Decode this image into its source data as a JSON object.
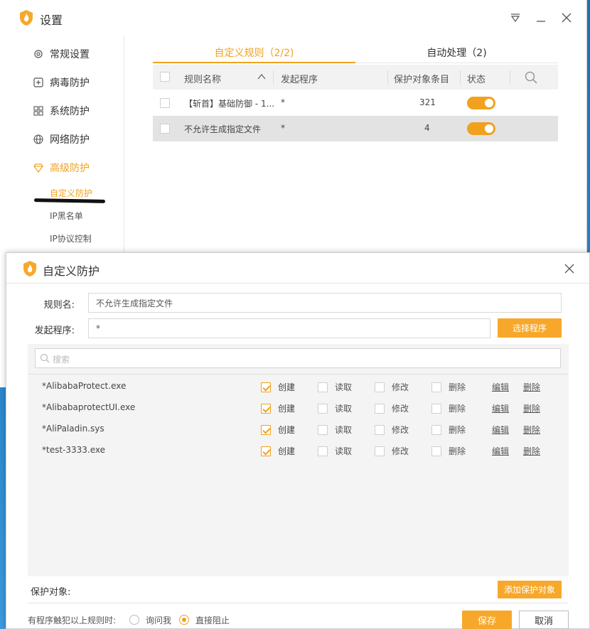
{
  "colors": {
    "accent": "#f0a21e",
    "button": "#f7a82a",
    "selected_row": "#e3e3e3"
  },
  "main_window": {
    "title": "设置",
    "controls": [
      "dropdown-icon",
      "minimize-icon",
      "close-icon"
    ],
    "sidebar": {
      "items": [
        {
          "label": "常规设置",
          "icon": "gear-icon"
        },
        {
          "label": "病毒防护",
          "icon": "plus-box-icon"
        },
        {
          "label": "系统防护",
          "icon": "grid-icon"
        },
        {
          "label": "网络防护",
          "icon": "globe-icon"
        },
        {
          "label": "高级防护",
          "icon": "diamond-icon",
          "active": true
        }
      ],
      "subitems": [
        {
          "label": "自定义防护",
          "active": true
        },
        {
          "label": "IP黑名单"
        },
        {
          "label": "IP协议控制"
        }
      ]
    },
    "tabs": [
      {
        "label": "自定义规则（2/2)",
        "active": true
      },
      {
        "label": "自动处理（2)"
      }
    ],
    "table": {
      "headers": [
        "规则名称",
        "发起程序",
        "保护对象条目",
        "状态"
      ],
      "rows": [
        {
          "name": "【斩首】基础防御 - 1...",
          "program": "*",
          "count": "321",
          "enabled": true
        },
        {
          "name": "不允许生成指定文件",
          "program": "*",
          "count": "4",
          "enabled": true,
          "selected": true
        }
      ]
    }
  },
  "dialog": {
    "title": "自定义防护",
    "rule_name_label": "规则名:",
    "rule_name_value": "不允许生成指定文件",
    "program_label": "发起程序:",
    "program_value": "*",
    "select_program_button": "选择程序",
    "search_placeholder": "搜索",
    "permission_labels": [
      "创建",
      "读取",
      "修改",
      "删除"
    ],
    "edit_label": "编辑",
    "delete_label": "删除",
    "entries": [
      {
        "name": "*AlibabaProtect.exe",
        "create": true,
        "read": false,
        "modify": false,
        "delete": false
      },
      {
        "name": "*AlibabaprotectUI.exe",
        "create": true,
        "read": false,
        "modify": false,
        "delete": false
      },
      {
        "name": "*AliPaladin.sys",
        "create": true,
        "read": false,
        "modify": false,
        "delete": false
      },
      {
        "name": "*test-3333.exe",
        "create": true,
        "read": false,
        "modify": false,
        "delete": false
      }
    ],
    "protect_target_label": "保护对象:",
    "add_target_button": "添加保护对象",
    "violation_label": "有程序触犯以上规则时:",
    "options": [
      {
        "label": "询问我",
        "selected": false
      },
      {
        "label": "直接阻止",
        "selected": true
      }
    ],
    "save_button": "保存",
    "cancel_button": "取消"
  }
}
